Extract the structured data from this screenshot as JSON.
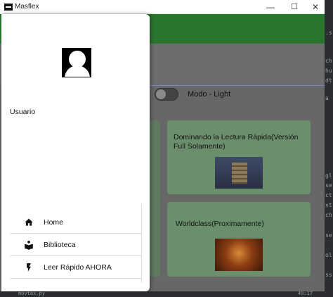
{
  "window": {
    "title": "Masflex",
    "min_label": "—",
    "max_label": "☐",
    "close_label": "✕"
  },
  "drawer": {
    "user_label": "Usuario",
    "menu": [
      {
        "label": "Home",
        "icon": "home-icon"
      },
      {
        "label": "Biblioteca",
        "icon": "book-reader-icon"
      },
      {
        "label": "Leer Rápido AHORA",
        "icon": "flash-icon"
      }
    ]
  },
  "main": {
    "mode_label": "Modo - Light",
    "cards": [
      {
        "title": "Dominando la Lectura Rápida(Versión Full Solamente)",
        "image": "books-image"
      },
      {
        "title": "Worldclass(Proximamente)",
        "image": "hall-image"
      }
    ]
  },
  "ide": {
    "right_fragments": [
      ".s",
      "ch",
      "hu",
      "dt",
      "a",
      "gl",
      "se",
      "ct",
      "xt",
      "ch",
      "se",
      "ol",
      "ss"
    ],
    "bottom_file": "movtex.py",
    "bottom_pos": "49:17"
  },
  "colors": {
    "app_bar": "#2e7d32",
    "card": "#6b8f6d",
    "drawer": "#ffffff"
  }
}
